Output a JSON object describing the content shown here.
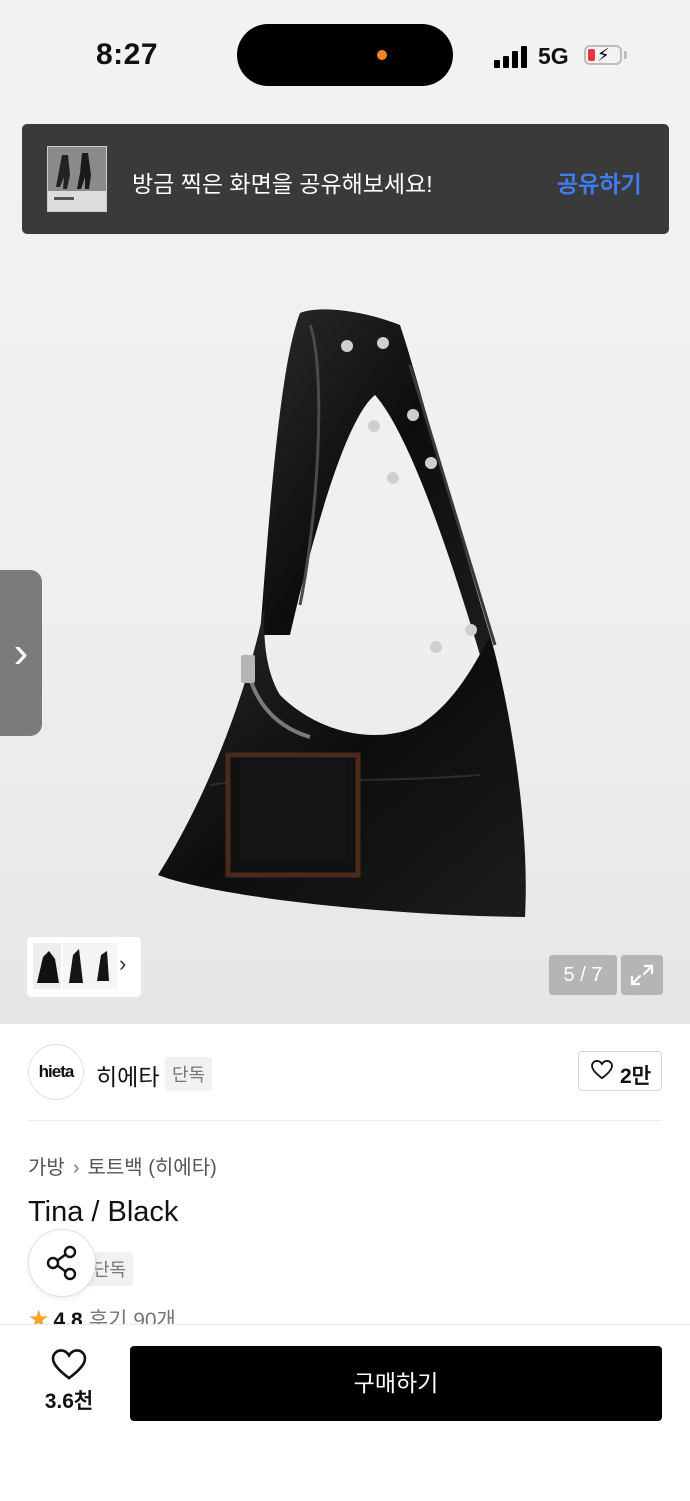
{
  "status_bar": {
    "time": "8:27",
    "network": "5G"
  },
  "share_banner": {
    "text": "방금 찍은 화면을 공유해보세요!",
    "button": "공유하기"
  },
  "gallery": {
    "counter": "5 / 7"
  },
  "brand": {
    "logo_text": "hieta",
    "name": "히에타",
    "tag": "단독",
    "likes": "2만"
  },
  "breadcrumb": [
    "가방",
    "토트백 (히에타)"
  ],
  "product": {
    "title": "Tina / Black",
    "tag": "단독",
    "rating": "4.8",
    "reviews": "후기 90개"
  },
  "bottom_bar": {
    "wish_count": "3.6천",
    "buy_label": "구매하기"
  },
  "colors": {
    "accent": "#3f7df5",
    "buy_button": "#000000",
    "star": "#f5a623"
  }
}
